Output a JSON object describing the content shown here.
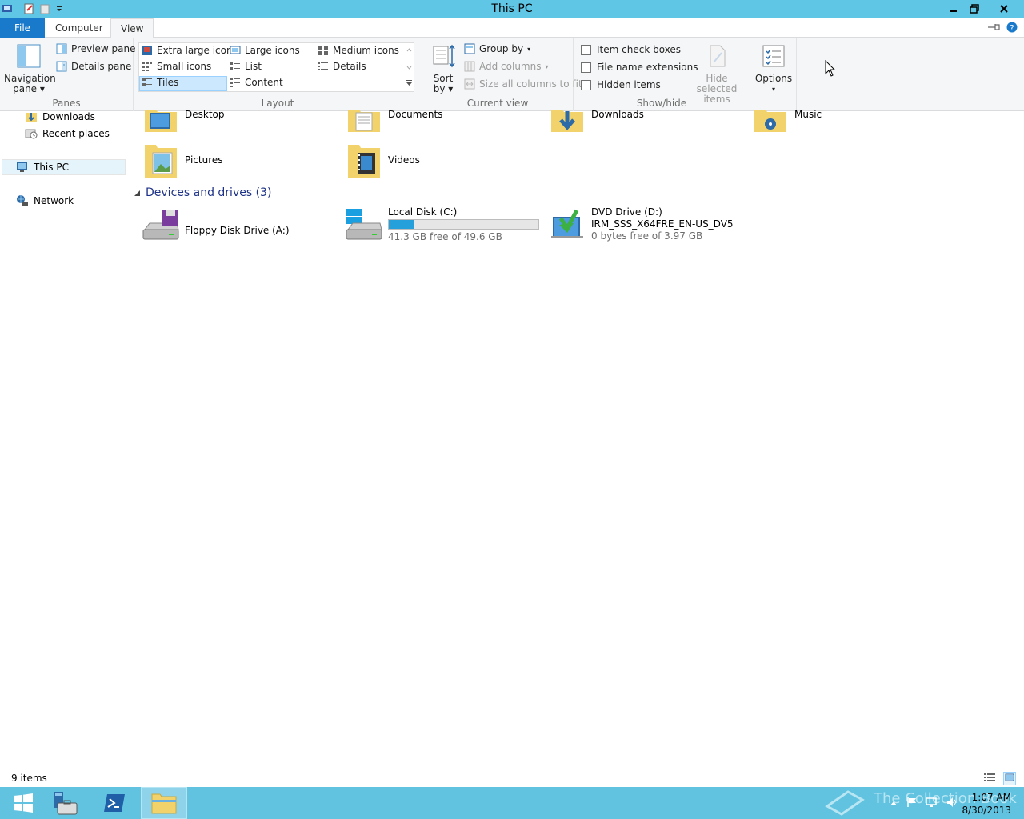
{
  "window": {
    "title": "This PC"
  },
  "ribbon": {
    "tabs": {
      "file": "File",
      "computer": "Computer",
      "view": "View"
    },
    "panes": {
      "nav_pane_line1": "Navigation",
      "nav_pane_line2": "pane",
      "preview_pane": "Preview pane",
      "details_pane": "Details pane",
      "label": "Panes"
    },
    "layout": {
      "extra_large": "Extra large icons",
      "large": "Large icons",
      "medium": "Medium icons",
      "small": "Small icons",
      "list": "List",
      "details": "Details",
      "tiles": "Tiles",
      "content": "Content",
      "label": "Layout",
      "selected": "Tiles"
    },
    "current_view": {
      "sort_line1": "Sort",
      "sort_line2": "by",
      "group_by": "Group by",
      "add_columns": "Add columns",
      "size_columns": "Size all columns to fit",
      "label": "Current view"
    },
    "show_hide": {
      "item_check_boxes": "Item check boxes",
      "file_name_extensions": "File name extensions",
      "hidden_items": "Hidden items",
      "hide_selected_line1": "Hide selected",
      "hide_selected_line2": "items",
      "label": "Show/hide"
    },
    "options": {
      "label": "Options"
    }
  },
  "nav": {
    "downloads": "Downloads",
    "recent_places": "Recent places",
    "this_pc": "This PC",
    "network": "Network"
  },
  "folders": [
    {
      "name": "Desktop",
      "icon": "desktop-folder-icon"
    },
    {
      "name": "Documents",
      "icon": "documents-folder-icon"
    },
    {
      "name": "Downloads",
      "icon": "downloads-folder-icon"
    },
    {
      "name": "Music",
      "icon": "music-folder-icon"
    },
    {
      "name": "Pictures",
      "icon": "pictures-folder-icon"
    },
    {
      "name": "Videos",
      "icon": "videos-folder-icon"
    }
  ],
  "devices": {
    "header": "Devices and drives (3)",
    "items": [
      {
        "name": "Floppy Disk Drive (A:)"
      },
      {
        "name": "Local Disk (C:)",
        "free": "41.3 GB free of 49.6 GB",
        "used_fraction": 0.167
      },
      {
        "name": "DVD Drive (D:)",
        "label": "IRM_SSS_X64FRE_EN-US_DV5",
        "free": "0 bytes free of 3.97 GB"
      }
    ]
  },
  "status": {
    "count": "9 items"
  },
  "taskbar": {
    "time": "1:07 AM",
    "date": "8/30/2013",
    "watermark": "The Collection Book"
  },
  "colors": {
    "titlebar": "#5fc6e6",
    "file_tab": "#1979ca",
    "taskbar": "#62c3e0",
    "progress": "#26a0da"
  }
}
